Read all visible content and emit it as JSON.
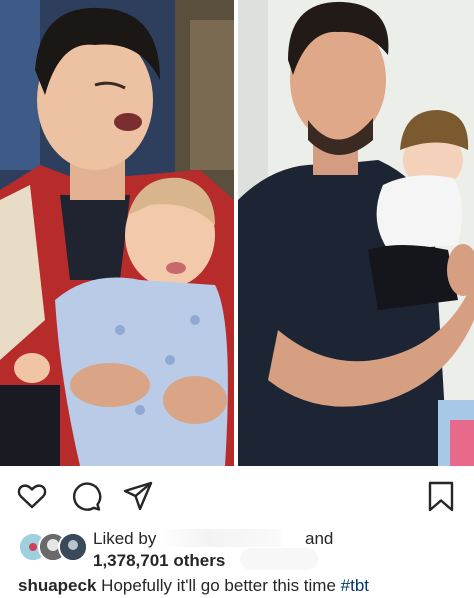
{
  "post": {
    "likes": {
      "prefix": "Liked by",
      "connector": "and",
      "count": "1,378,701",
      "others_label": "others"
    },
    "caption": {
      "username": "shuapeck",
      "text": "Hopefully it'll go better this time",
      "hashtag": "#tbt"
    }
  },
  "icons": {
    "like": "heart-icon",
    "comment": "comment-icon",
    "share": "send-icon",
    "save": "bookmark-icon"
  },
  "colors": {
    "text": "#262626",
    "hashtag": "#00376b"
  }
}
